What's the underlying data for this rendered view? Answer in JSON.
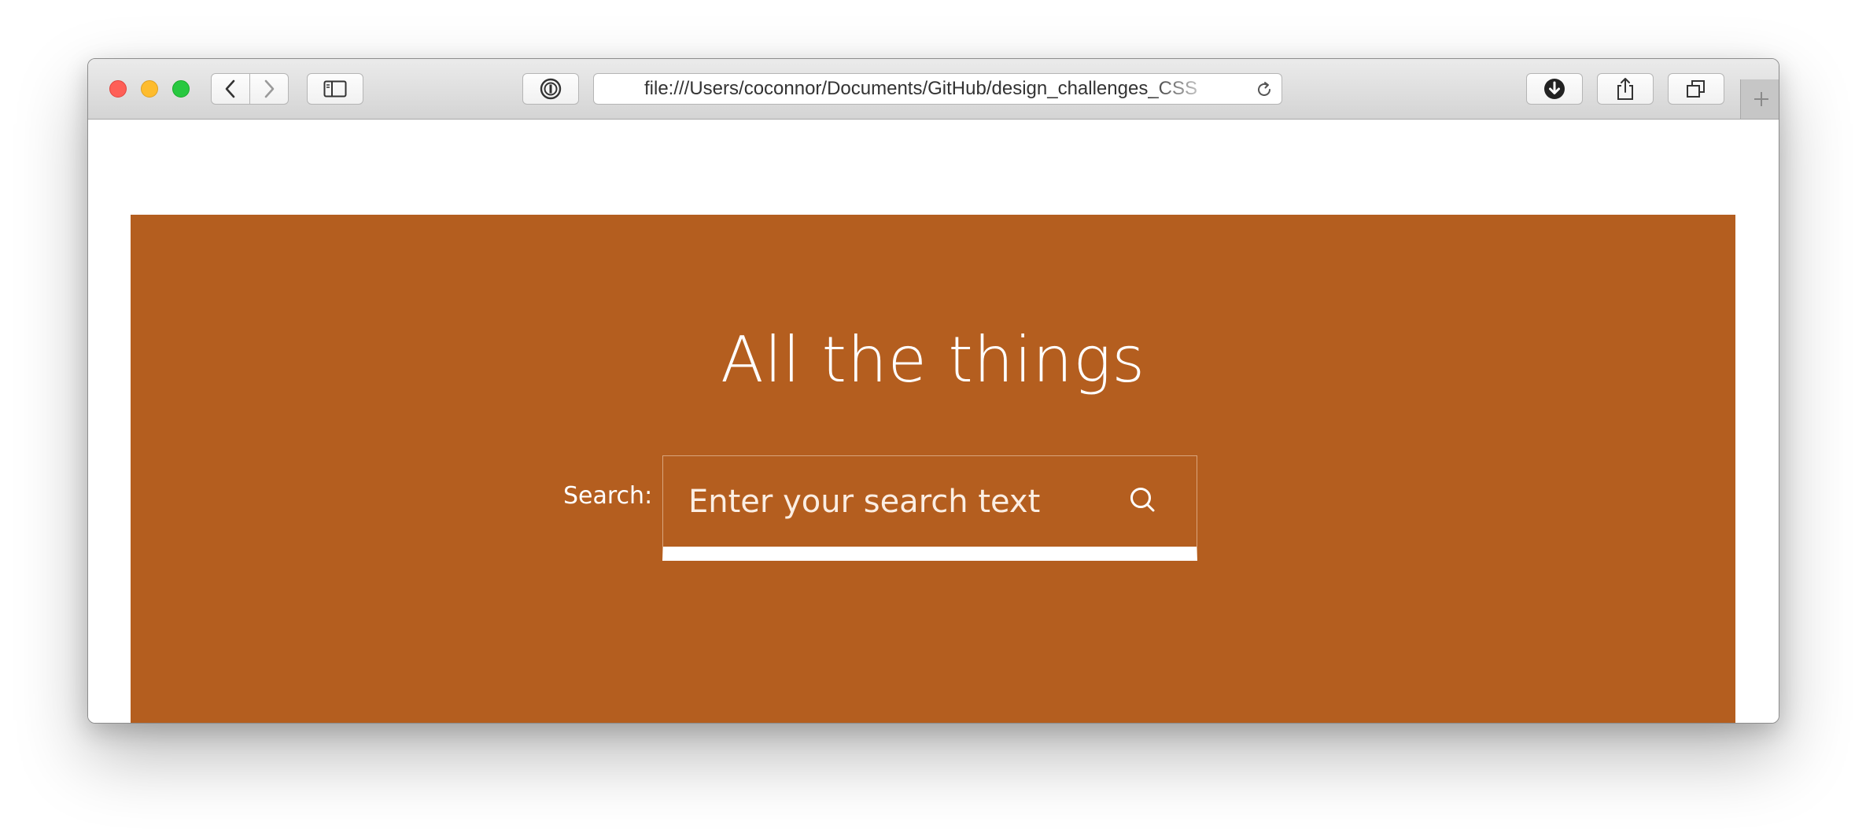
{
  "browser": {
    "url": "file:///Users/coconnor/Documents/GitHub/design_challenges_CSS",
    "icons": {
      "back": "chevron-left-icon",
      "forward": "chevron-right-icon",
      "sidebar": "sidebar-icon",
      "password_manager": "1password-icon",
      "reload": "reload-icon",
      "download": "download-icon",
      "share": "share-icon",
      "tabs": "tabs-icon",
      "new_tab": "plus-icon"
    }
  },
  "hero": {
    "title": "All the things",
    "background_color": "#b45e1f",
    "search_label": "Search:",
    "search_placeholder": "Enter your search text",
    "search_icon": "search-icon"
  }
}
